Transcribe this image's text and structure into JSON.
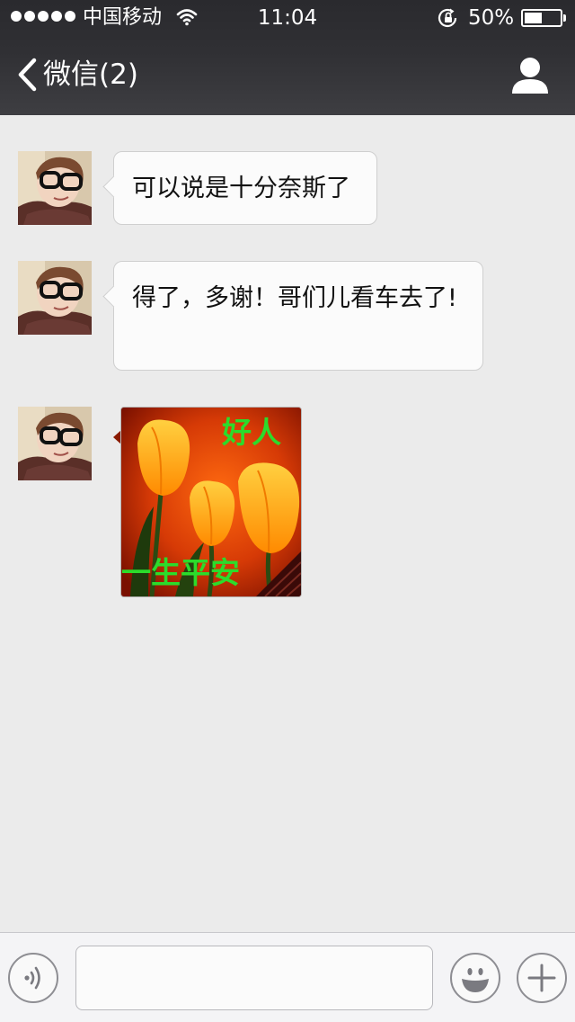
{
  "status_bar": {
    "carrier": "中国移动",
    "time": "11:04",
    "battery_percent_label": "50%",
    "battery_level": 0.5,
    "signal_dots": 5,
    "icons": [
      "signal-dots-icon",
      "wifi-icon",
      "rotation-lock-icon",
      "battery-icon"
    ]
  },
  "nav": {
    "back_label": "微信(2)",
    "back_icon": "chevron-left-icon",
    "right_icon": "person-icon"
  },
  "messages": [
    {
      "sender": "other",
      "type": "text",
      "text": "可以说是十分奈斯了"
    },
    {
      "sender": "other",
      "type": "text",
      "text": "得了，多谢！哥们儿看车去了!"
    },
    {
      "sender": "other",
      "type": "image",
      "image_content": "tulips-sticker",
      "caption_top": "好人",
      "caption_bottom": "一生平安"
    }
  ],
  "input_bar": {
    "voice_icon": "voice-input-icon",
    "text_value": "",
    "emoji_icon": "smiley-icon",
    "more_icon": "plus-icon"
  },
  "colors": {
    "nav_bg": "#2e2e32",
    "chat_bg": "#ebebeb",
    "bubble_bg": "#fbfbfb",
    "sticker_caption": "#2bdc2b"
  }
}
